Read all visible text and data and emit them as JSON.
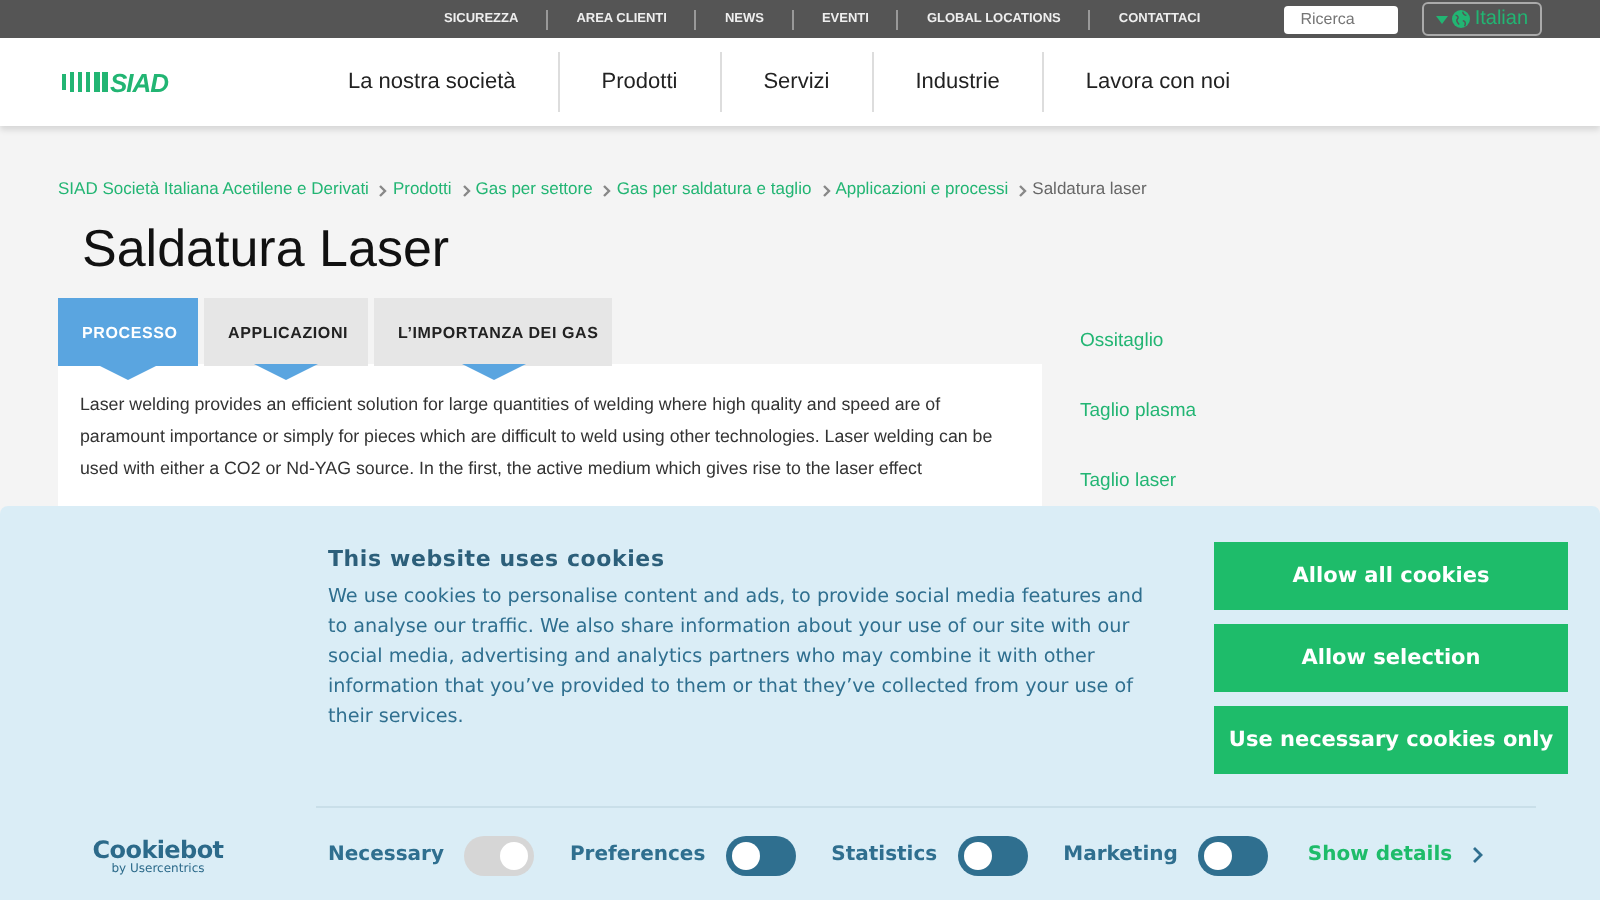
{
  "top_links": [
    "SICUREZZA",
    "AREA CLIENTI",
    "NEWS",
    "EVENTI",
    "GLOBAL LOCATIONS",
    "CONTATTACI"
  ],
  "search": {
    "placeholder": "Ricerca"
  },
  "language": {
    "label": "Italian"
  },
  "logo": {
    "text": "SIAD"
  },
  "nav": [
    "La nostra società",
    "Prodotti",
    "Servizi",
    "Industrie",
    "Lavora con noi"
  ],
  "breadcrumb": [
    {
      "label": "SIAD Società Italiana Acetilene e Derivati",
      "link": true
    },
    {
      "label": "Prodotti",
      "link": true
    },
    {
      "label": "Gas per settore",
      "link": true
    },
    {
      "label": "Gas per saldatura e taglio",
      "link": true
    },
    {
      "label": "Applicazioni e processi",
      "link": true
    },
    {
      "label": "Saldatura laser",
      "link": false
    }
  ],
  "title": "Saldatura Laser",
  "tabs": [
    {
      "label": "PROCESSO",
      "selected": true
    },
    {
      "label": "APPLICAZIONI",
      "selected": false
    },
    {
      "label": "L’IMPORTANZA DEI GAS",
      "selected": false
    }
  ],
  "body": "Laser welding provides an efficient solution for large quantities of welding where high quality and speed are of paramount importance or simply for pieces which are difficult to weld using other technologies.  Laser welding can be used with either a CO2 or Nd-YAG source. In the first, the active medium which gives rise to the laser effect",
  "side_links": [
    "Ossitaglio",
    "Taglio plasma",
    "Taglio laser"
  ],
  "cookie_banner": {
    "title": "This website uses cookies",
    "text": "We use cookies to personalise content and ads, to provide social media features and to analyse our traffic. We also share information about your use of our site with our social media, advertising and analytics partners who may combine it with other information that you’ve provided to them or that they’ve collected from your use of their services.",
    "buttons": [
      "Allow all cookies",
      "Allow selection",
      "Use necessary cookies only"
    ],
    "brand": "Cookiebot",
    "brand_sub": "by Usercentrics",
    "toggles": [
      {
        "label": "Necessary",
        "on": true,
        "disabled": true
      },
      {
        "label": "Preferences",
        "on": false,
        "disabled": false
      },
      {
        "label": "Statistics",
        "on": false,
        "disabled": false
      },
      {
        "label": "Marketing",
        "on": false,
        "disabled": false
      }
    ],
    "details": "Show details"
  }
}
